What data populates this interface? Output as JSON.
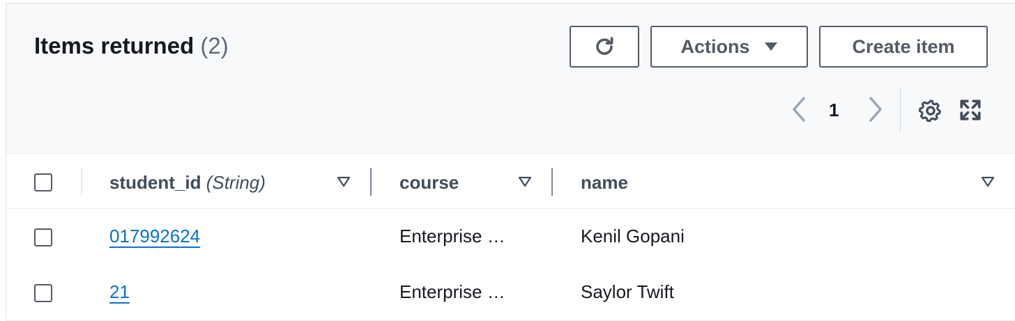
{
  "header": {
    "title": "Items returned",
    "count": "(2)",
    "refresh_icon": "refresh-icon",
    "actions_label": "Actions",
    "create_label": "Create item"
  },
  "pagination": {
    "current_page": "1",
    "prev_icon": "chevron-left-icon",
    "next_icon": "chevron-right-icon"
  },
  "toolbar": {
    "settings_icon": "gear-icon",
    "fullscreen_icon": "fullscreen-icon"
  },
  "table": {
    "columns": [
      {
        "label": "student_id",
        "type": "(String)"
      },
      {
        "label": "course"
      },
      {
        "label": "name"
      }
    ],
    "rows": [
      {
        "student_id": "017992624",
        "course": "Enterprise …",
        "name": "Kenil Gopani"
      },
      {
        "student_id": "21",
        "course": "Enterprise …",
        "name": "Saylor Twift"
      }
    ]
  },
  "colors": {
    "link": "#0972d3",
    "header_bg": "#f8f9fa",
    "border": "#545b64"
  }
}
